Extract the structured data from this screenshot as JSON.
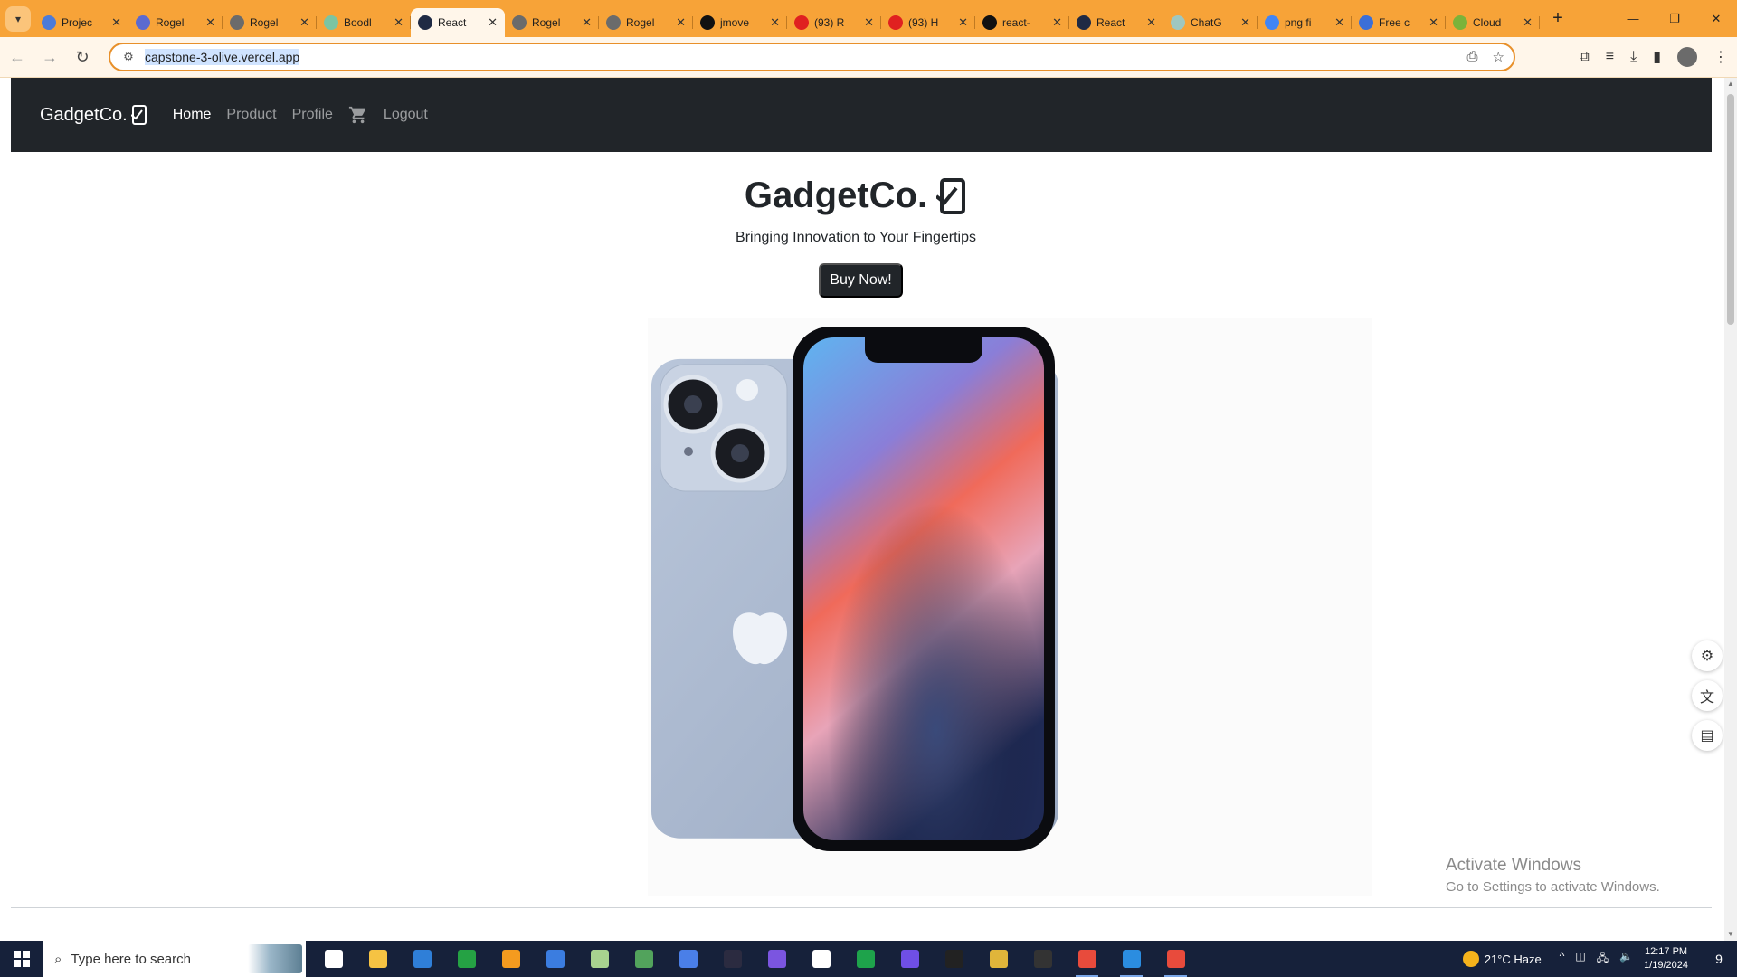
{
  "browser": {
    "tabs": [
      {
        "title": "Projec",
        "favicon_color": "#4c7bd9"
      },
      {
        "title": "Rogel",
        "favicon_color": "#5b6ad0"
      },
      {
        "title": "Rogel",
        "favicon_color": "#6b6b6b"
      },
      {
        "title": "Boodl",
        "favicon_color": "#7cc4a2"
      },
      {
        "title": "React",
        "favicon_color": "#1f2a44",
        "active": true
      },
      {
        "title": "Rogel",
        "favicon_color": "#6b6b6b"
      },
      {
        "title": "Rogel",
        "favicon_color": "#6b6b6b"
      },
      {
        "title": "jmove",
        "favicon_color": "#111111"
      },
      {
        "title": "(93) R",
        "favicon_color": "#e02020"
      },
      {
        "title": "(93) H",
        "favicon_color": "#e02020"
      },
      {
        "title": "react-",
        "favicon_color": "#111111"
      },
      {
        "title": "React",
        "favicon_color": "#1f2a44"
      },
      {
        "title": "ChatG",
        "favicon_color": "#9fc7c0"
      },
      {
        "title": "png fi",
        "favicon_color": "#4285f4"
      },
      {
        "title": "Free c",
        "favicon_color": "#3b6fd8"
      },
      {
        "title": "Cloud",
        "favicon_color": "#7bb33a"
      }
    ],
    "url": "capstone-3-olive.vercel.app"
  },
  "site": {
    "brand": "GadgetCo.",
    "nav": [
      {
        "label": "Home",
        "active": true
      },
      {
        "label": "Product",
        "active": false
      },
      {
        "label": "Profile",
        "active": false
      }
    ],
    "logout_label": "Logout",
    "hero": {
      "title": "GadgetCo.",
      "subtitle": "Bringing Innovation to Your Fingertips",
      "button_label": "Buy Now!"
    }
  },
  "watermark": {
    "line1": "Activate Windows",
    "line2": "Go to Settings to activate Windows."
  },
  "taskbar": {
    "search_placeholder": "Type here to search",
    "apps": [
      {
        "name": "task-view",
        "color": "#ffffff"
      },
      {
        "name": "file-explorer",
        "color": "#f6c343"
      },
      {
        "name": "mail",
        "color": "#2f7fd8"
      },
      {
        "name": "chat",
        "color": "#25a244"
      },
      {
        "name": "sublime",
        "color": "#f49b1f"
      },
      {
        "name": "store",
        "color": "#3b7de0"
      },
      {
        "name": "photos",
        "color": "#a8d38f"
      },
      {
        "name": "recycle",
        "color": "#52a35c"
      },
      {
        "name": "docs",
        "color": "#4a7fe8"
      },
      {
        "name": "ax",
        "color": "#2b2b40"
      },
      {
        "name": "s-app",
        "color": "#7b55e0"
      },
      {
        "name": "postman",
        "color": "#ffffff"
      },
      {
        "name": "mongodb",
        "color": "#1ea34b"
      },
      {
        "name": "feather",
        "color": "#6f4fe6"
      },
      {
        "name": "dots",
        "color": "#222222"
      },
      {
        "name": "git",
        "color": "#e0b53a"
      },
      {
        "name": "s-dark",
        "color": "#333333"
      },
      {
        "name": "chrome",
        "color": "#e84b3c",
        "running": true
      },
      {
        "name": "vscode",
        "color": "#2b8de0",
        "running": true
      },
      {
        "name": "chrome-2",
        "color": "#e84b3c",
        "running": true
      }
    ],
    "weather": "21°C  Haze",
    "time": "12:17 PM",
    "date": "1/19/2024",
    "notification_count": "9"
  }
}
